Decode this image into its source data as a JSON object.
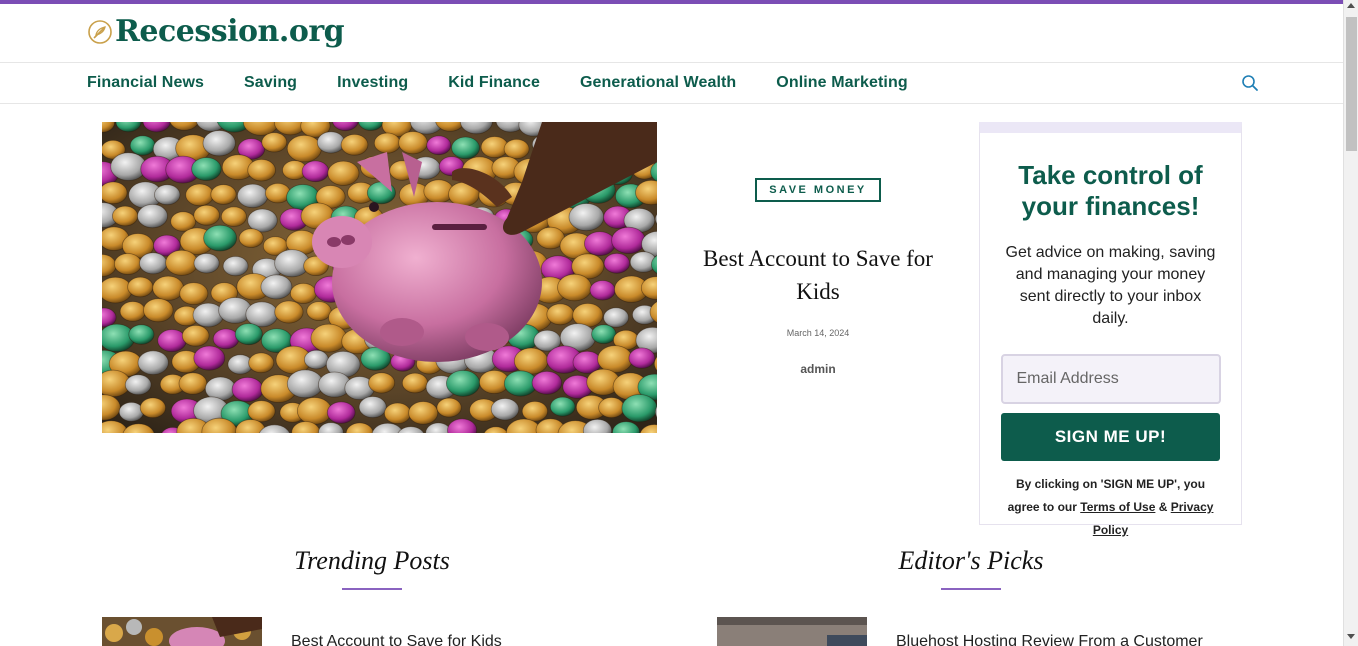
{
  "site": {
    "name": "Recession.org"
  },
  "nav": {
    "items": [
      "Financial News",
      "Saving",
      "Investing",
      "Kid Finance",
      "Generational Wealth",
      "Online Marketing"
    ]
  },
  "hero": {
    "category": "SAVE MONEY",
    "title": "Best Account to Save for Kids",
    "date": "March 14, 2024",
    "author": "admin"
  },
  "signup": {
    "title": "Take control of your finances!",
    "description": "Get advice on making, saving and managing your money sent directly to your inbox daily.",
    "email_placeholder": "Email Address",
    "button_label": "SIGN ME UP!",
    "legal_prefix": "By clicking on 'SIGN ME UP', you agree to our ",
    "terms_label": "Terms of Use",
    "legal_and": " & ",
    "privacy_label": "Privacy Policy"
  },
  "sections": {
    "trending_title": "Trending Posts",
    "editors_title": "Editor's Picks"
  },
  "trending_posts": [
    {
      "title": "Best Account to Save for Kids"
    }
  ],
  "editors_picks": [
    {
      "title": "Bluehost Hosting Review From a Customer"
    }
  ],
  "colors": {
    "brand_green": "#0d5c4c",
    "accent_purple": "#7b4db5",
    "section_rule": "#8a63c0"
  },
  "icons": {
    "logo": "leaf-circle-icon",
    "search": "search-icon"
  }
}
